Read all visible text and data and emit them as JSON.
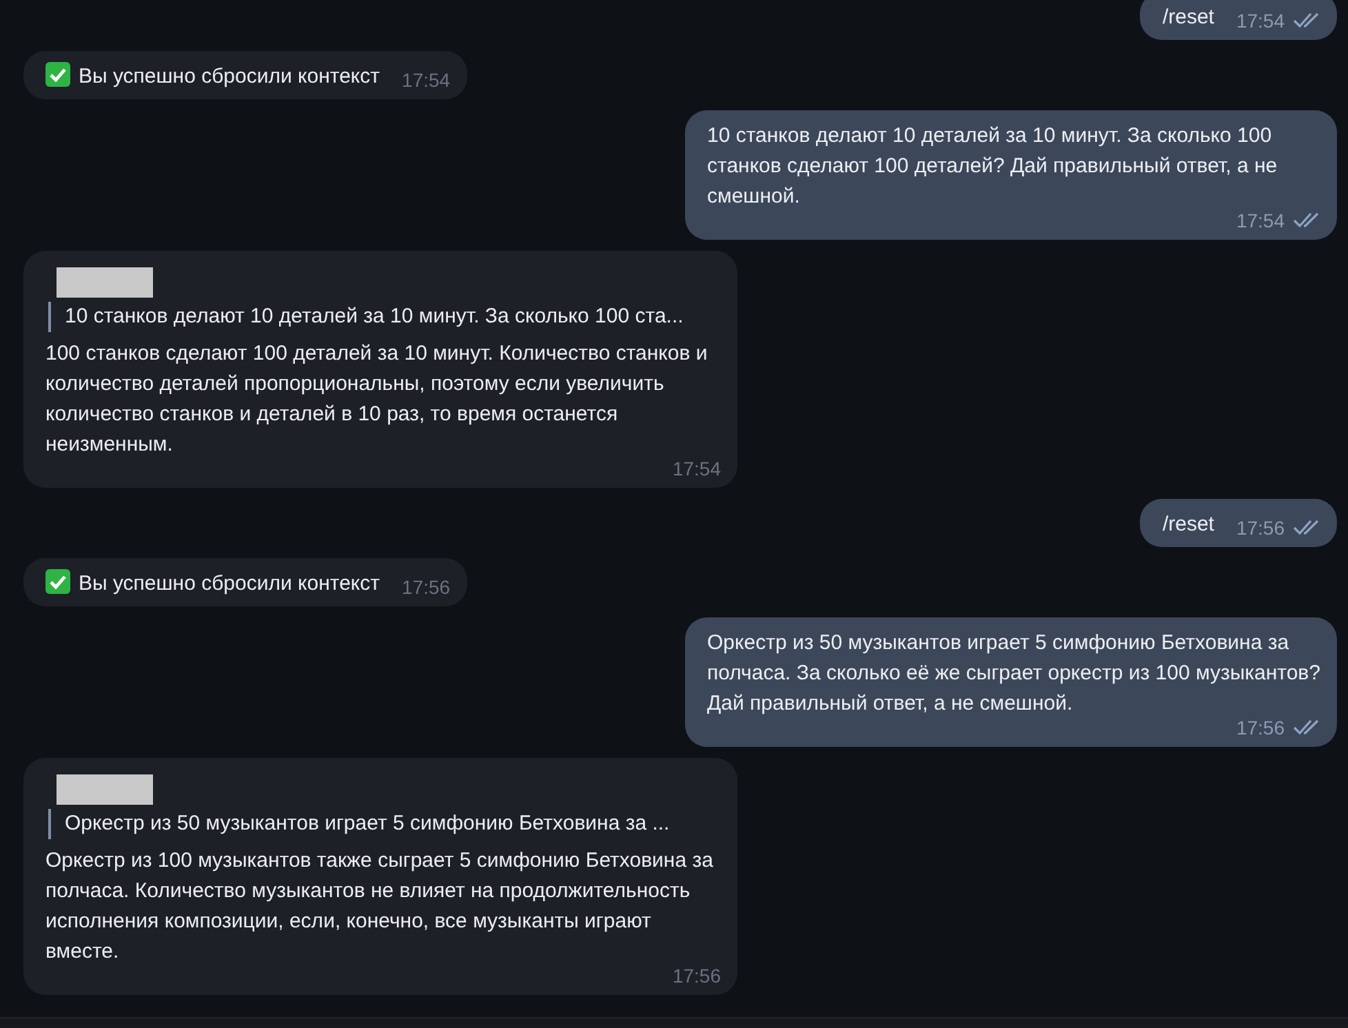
{
  "messages": [
    {
      "kind": "outgoing",
      "text": "/reset",
      "time": "17:54",
      "read": true
    },
    {
      "kind": "status",
      "text": "Вы успешно сбросили контекст",
      "time": "17:54"
    },
    {
      "kind": "outgoing",
      "text": "10 станков делают 10 деталей за 10 минут. За сколько 100 станков сделают 100 деталей? Дай правильный ответ, а не смешной.",
      "time": "17:54",
      "read": true
    },
    {
      "kind": "incoming",
      "redacted_sender": true,
      "quote": "10 станков делают 10 деталей за 10 минут. За сколько 100 ста...",
      "text": "100 станков сделают 100 деталей за 10 минут. Количество станков и количество деталей пропорциональны, поэтому если увеличить количество станков и деталей в 10 раз, то время останется неизменным.",
      "time": "17:54"
    },
    {
      "kind": "outgoing",
      "text": "/reset",
      "time": "17:56",
      "read": true
    },
    {
      "kind": "status",
      "text": "Вы успешно сбросили контекст",
      "time": "17:56"
    },
    {
      "kind": "outgoing",
      "text": "Оркестр из 50 музыкантов играет 5 симфонию Бетховина за полчаса. За сколько её же сыграет оркестр из 100 музыкантов? Дай правильный ответ, а не смешной.",
      "time": "17:56",
      "read": true
    },
    {
      "kind": "incoming",
      "redacted_sender": true,
      "quote": "Оркестр из 50 музыкантов играет 5 симфонию Бетховина за ...",
      "text": "Оркестр из 100 музыкантов также сыграет 5 симфонию Бетховина за полчаса. Количество музыкантов не влияет на продолжительность исполнения композиции, если, конечно, все музыканты играют вместе.",
      "time": "17:56"
    }
  ]
}
